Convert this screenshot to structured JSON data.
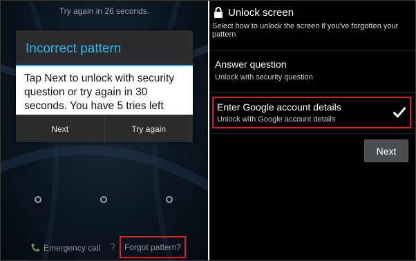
{
  "left_screen": {
    "countdown": "Try again in 26 seconds.",
    "dialog": {
      "title": "Incorrect pattern",
      "message": "Tap Next to unlock with security question or try again in 30 seconds. You have 5 tries left",
      "buttons": [
        "Next",
        "Try again"
      ]
    },
    "emergency_call": "Emergency call",
    "forgot_pattern": "Forgot pattern?"
  },
  "right_screen": {
    "title": "Unlock screen",
    "subtitle": "Select how to unlock the screen if you've forgotten your pattern",
    "options": [
      {
        "label": "Answer question",
        "sublabel": "Unlock with security question",
        "selected": false
      },
      {
        "label": "Enter Google account details",
        "sublabel": "Unlock with Google account details",
        "selected": true
      }
    ],
    "next_button": "Next"
  },
  "colors": {
    "accent": "#33b5e5",
    "highlight": "#d81e2a"
  }
}
